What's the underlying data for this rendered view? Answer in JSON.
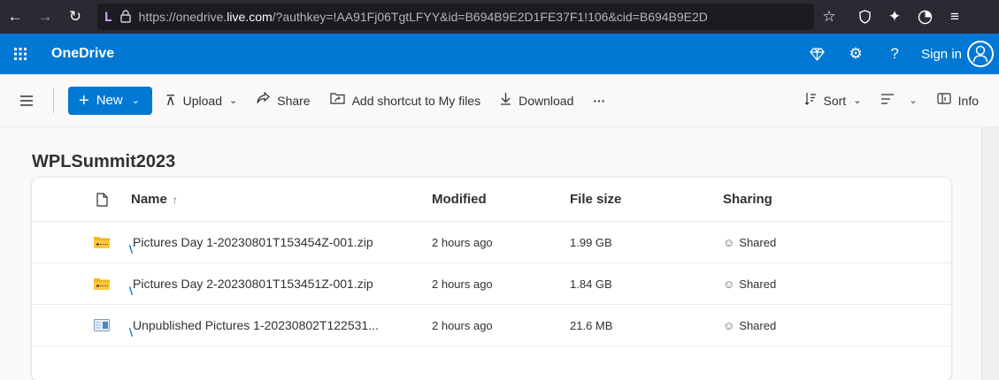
{
  "browser": {
    "url_prefix": "https://onedrive.",
    "url_host": "live.com",
    "url_suffix": "/?authkey=!AA91Fj06TgtLFYY&id=B694B9E2D1FE37F1!106&cid=B694B9E2D",
    "icons": [
      "back-icon",
      "forward-icon",
      "reload-icon",
      "extension-icon",
      "lock-icon",
      "star-icon",
      "shield-icon",
      "tools-icon",
      "timer-icon",
      "menu-icon"
    ]
  },
  "header": {
    "app_name": "OneDrive",
    "sign_in": "Sign in",
    "accent": "#0078d4"
  },
  "commandbar": {
    "new_label": "New",
    "upload_label": "Upload",
    "share_label": "Share",
    "shortcut_label": "Add shortcut to My files",
    "download_label": "Download",
    "more_label": "···",
    "sort_label": "Sort",
    "info_label": "Info"
  },
  "folder": {
    "title": "WPLSummit2023"
  },
  "table": {
    "columns": {
      "name": "Name",
      "name_sort": "↑",
      "modified": "Modified",
      "size": "File size",
      "sharing": "Sharing"
    },
    "rows": [
      {
        "icon": "zip-folder-icon",
        "name": "Pictures Day 1-20230801T153454Z-001.zip",
        "modified": "2 hours ago",
        "size": "1.99 GB",
        "sharing": "Shared"
      },
      {
        "icon": "zip-folder-icon",
        "name": "Pictures Day 2-20230801T153451Z-001.zip",
        "modified": "2 hours ago",
        "size": "1.84 GB",
        "sharing": "Shared"
      },
      {
        "icon": "gallery-folder-icon",
        "name": "Unpublished Pictures 1-20230802T122531...",
        "modified": "2 hours ago",
        "size": "21.6 MB",
        "sharing": "Shared"
      }
    ]
  }
}
